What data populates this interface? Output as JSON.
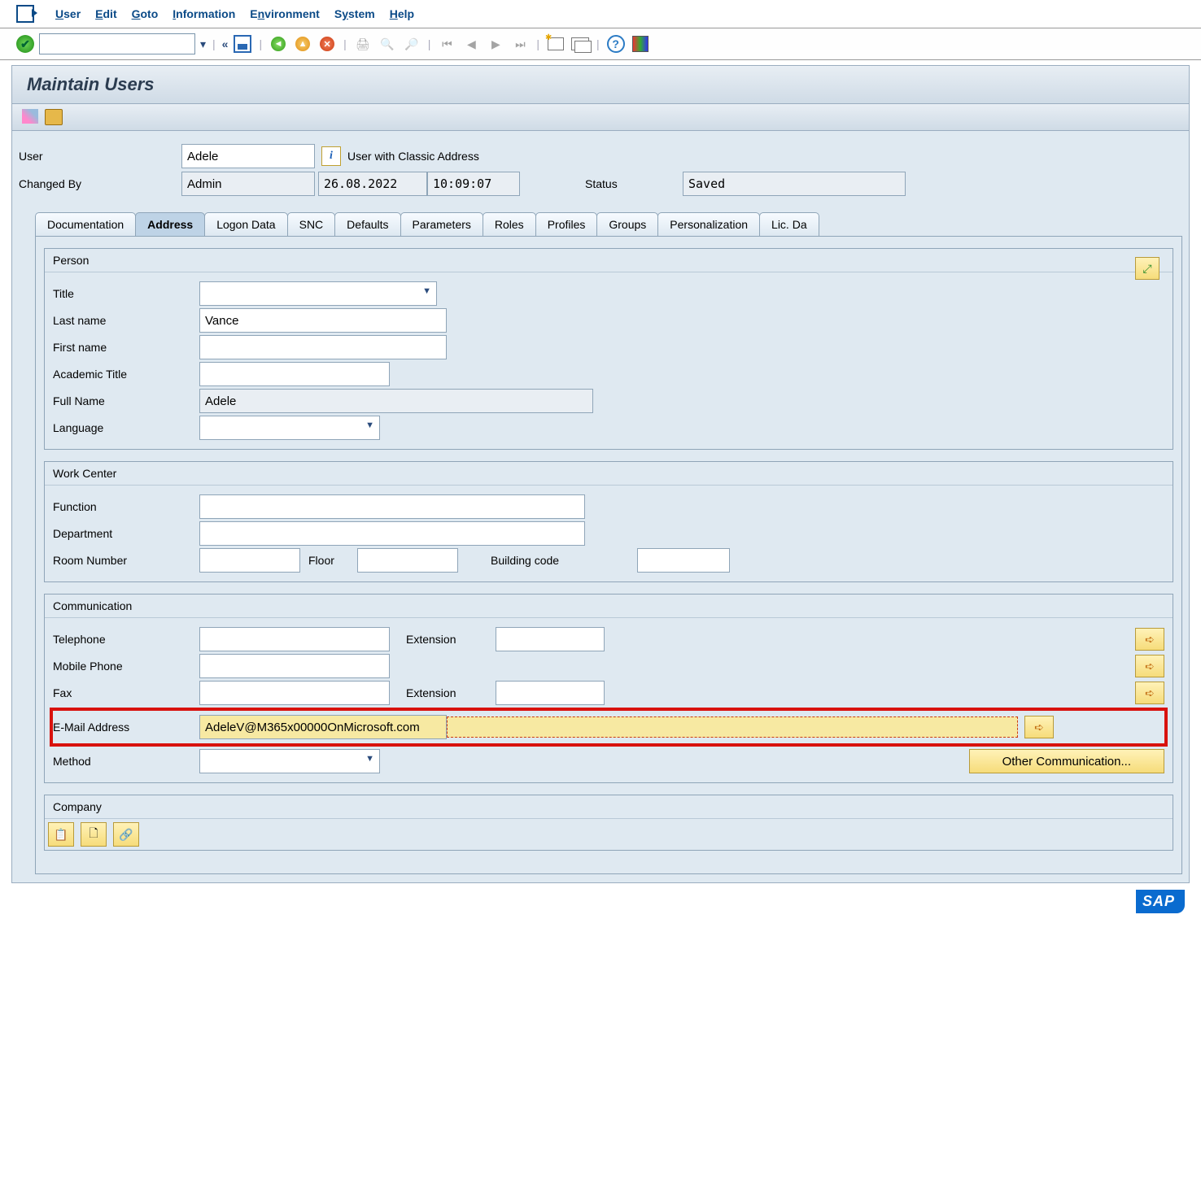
{
  "menu": {
    "user": "User",
    "edit": "Edit",
    "goto": "Goto",
    "info": "Information",
    "env": "Environment",
    "system": "System",
    "help": "Help"
  },
  "page_title": "Maintain Users",
  "header": {
    "user_label": "User",
    "user_value": "Adele",
    "user_type": "User with Classic Address",
    "changed_label": "Changed By",
    "changed_by": "Admin",
    "changed_date": "26.08.2022",
    "changed_time": "10:09:07",
    "status_label": "Status",
    "status_value": "Saved"
  },
  "tabs": [
    "Documentation",
    "Address",
    "Logon Data",
    "SNC",
    "Defaults",
    "Parameters",
    "Roles",
    "Profiles",
    "Groups",
    "Personalization",
    "Lic. Da"
  ],
  "active_tab": "Address",
  "person": {
    "title": "Person",
    "fields": {
      "title_label": "Title",
      "title_value": "",
      "last_label": "Last name",
      "last_value": "Vance",
      "first_label": "First name",
      "first_value": "",
      "acad_label": "Academic Title",
      "acad_value": "",
      "full_label": "Full Name",
      "full_value": "Adele",
      "lang_label": "Language",
      "lang_value": ""
    }
  },
  "work": {
    "title": "Work Center",
    "fields": {
      "func_label": "Function",
      "func_value": "",
      "dept_label": "Department",
      "dept_value": "",
      "room_label": "Room Number",
      "room_value": "",
      "floor_label": "Floor",
      "floor_value": "",
      "bld_label": "Building code",
      "bld_value": ""
    }
  },
  "comm": {
    "title": "Communication",
    "fields": {
      "tel_label": "Telephone",
      "tel_value": "",
      "tel_ext_label": "Extension",
      "tel_ext_value": "",
      "mob_label": "Mobile Phone",
      "mob_value": "",
      "fax_label": "Fax",
      "fax_value": "",
      "fax_ext_label": "Extension",
      "fax_ext_value": "",
      "email_label": "E-Mail Address",
      "email_value": "AdeleV@M365x00000OnMicrosoft.com",
      "method_label": "Method",
      "method_value": "",
      "other_btn": "Other Communication..."
    }
  },
  "company": {
    "title": "Company"
  },
  "logo": "SAP"
}
